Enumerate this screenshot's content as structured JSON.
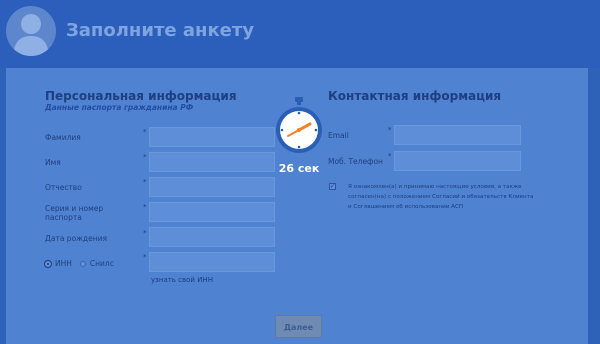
{
  "header": {
    "title": "Заполните анкету",
    "avatar_icon": "user-silhouette-icon"
  },
  "personal": {
    "title": "Персональная информация",
    "subtitle": "Данные паспорта гражданина РФ",
    "fields": {
      "lastname": "Фамилия",
      "firstname": "Имя",
      "patronymic": "Отчество",
      "passport_line1": "Серия и номер",
      "passport_line2": "паспорта",
      "birthdate": "Дата рождения"
    },
    "doc_type": {
      "options": [
        "ИНН",
        "Снилс"
      ],
      "selected": "ИНН"
    },
    "inn_link": "узнать свой ИНН",
    "required_mark": "*"
  },
  "contact": {
    "title": "Контактная информация",
    "fields": {
      "email": "Email",
      "phone": "Моб. Телефон"
    },
    "agree": {
      "checked": true,
      "text_a": "Я ознакомлен(а) и принимаю настоящие ",
      "link1": "условия",
      "text_b": ", а также согласен(на) с положением ",
      "link2": "Согласий и обязательств Клиента",
      "text_c": " и ",
      "link3": "Соглашением об использовании АСП",
      "check_mark": "✓"
    }
  },
  "actions": {
    "next_label": "Далее"
  },
  "timer": {
    "text": "26 сек",
    "icon": "stopwatch-icon"
  },
  "colors": {
    "background": "#2e62b8",
    "panel": "#5082d2",
    "title": "#1e3f80",
    "timer_face": "#2a5fb6",
    "timer_hand": "#f0832c"
  }
}
